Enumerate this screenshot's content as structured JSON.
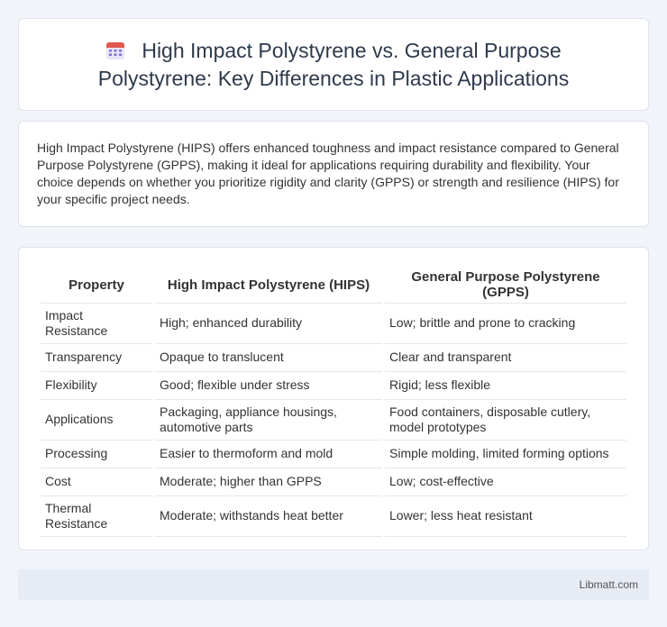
{
  "header": {
    "icon": "calendar-icon",
    "title": "High Impact Polystyrene vs. General Purpose Polystyrene: Key Differences in Plastic Applications"
  },
  "intro": {
    "text": "High Impact Polystyrene (HIPS) offers enhanced toughness and impact resistance compared to General Purpose Polystyrene (GPPS), making it ideal for applications requiring durability and flexibility. Your choice depends on whether you prioritize rigidity and clarity (GPPS) or strength and resilience (HIPS) for your specific project needs."
  },
  "table": {
    "headers": [
      "Property",
      "High Impact Polystyrene (HIPS)",
      "General Purpose Polystyrene (GPPS)"
    ],
    "rows": [
      [
        "Impact Resistance",
        "High; enhanced durability",
        "Low; brittle and prone to cracking"
      ],
      [
        "Transparency",
        "Opaque to translucent",
        "Clear and transparent"
      ],
      [
        "Flexibility",
        "Good; flexible under stress",
        "Rigid; less flexible"
      ],
      [
        "Applications",
        "Packaging, appliance housings, automotive parts",
        "Food containers, disposable cutlery, model prototypes"
      ],
      [
        "Processing",
        "Easier to thermoform and mold",
        "Simple molding, limited forming options"
      ],
      [
        "Cost",
        "Moderate; higher than GPPS",
        "Low; cost-effective"
      ],
      [
        "Thermal Resistance",
        "Moderate; withstands heat better",
        "Lower; less heat resistant"
      ]
    ]
  },
  "footer": {
    "brand": "Libmatt.com"
  }
}
